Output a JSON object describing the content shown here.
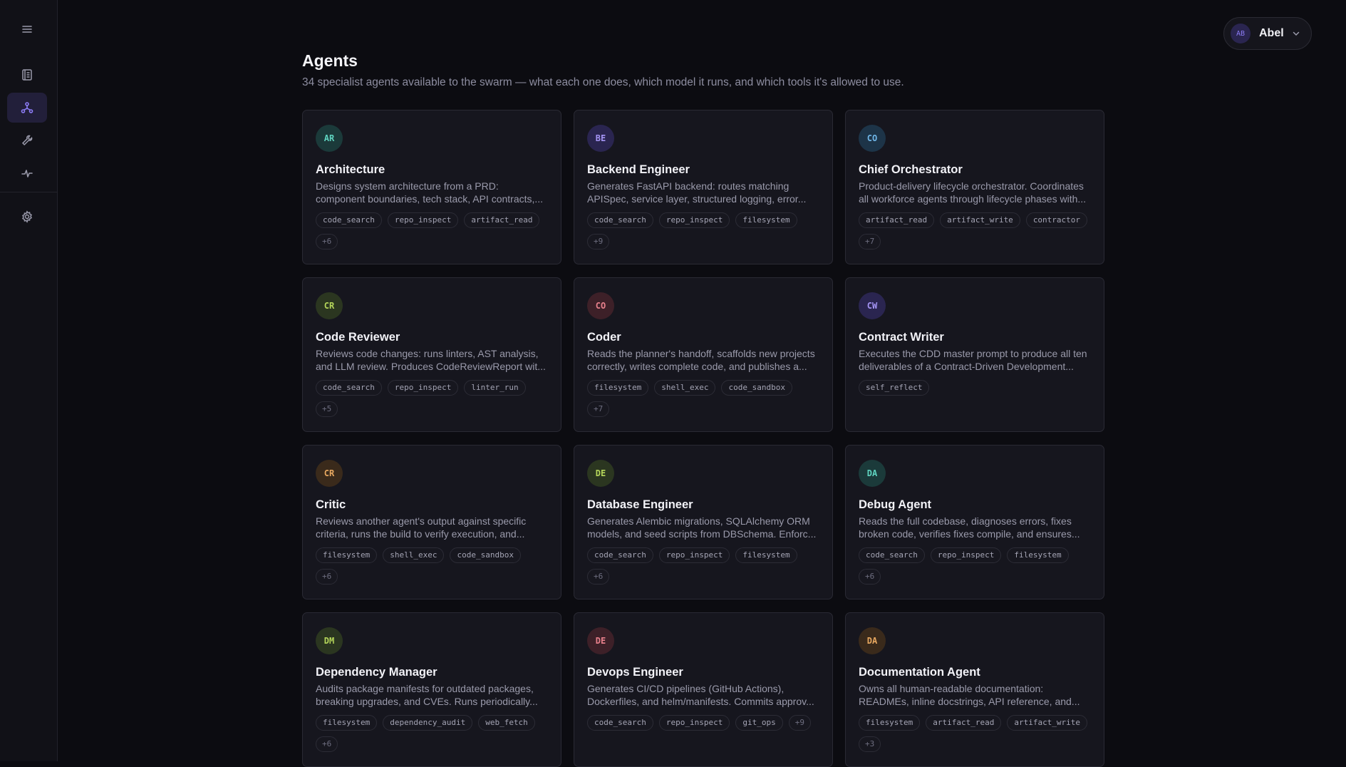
{
  "sidebar": {
    "items": [
      {
        "name": "menu-icon"
      },
      {
        "name": "docs-icon"
      },
      {
        "name": "agents-icon",
        "active": true
      },
      {
        "name": "tools-icon"
      },
      {
        "name": "activity-icon"
      },
      {
        "name": "settings-icon"
      }
    ]
  },
  "user": {
    "initials": "AB",
    "name": "Abel"
  },
  "header": {
    "title": "Agents",
    "subtitle": "34 specialist agents available to the swarm — what each one does, which model it runs, and which tools it's allowed to use."
  },
  "agents": [
    {
      "initials": "AR",
      "name": "Architecture",
      "desc": "Designs system architecture from a PRD: component boundaries, tech stack, API contracts,...",
      "tags": [
        "code_search",
        "repo_inspect",
        "artifact_read"
      ],
      "more": "+6",
      "color": "#5fd4c0",
      "bg": "#1b3a3a"
    },
    {
      "initials": "BE",
      "name": "Backend Engineer",
      "desc": "Generates FastAPI backend: routes matching APISpec, service layer, structured logging, error...",
      "tags": [
        "code_search",
        "repo_inspect",
        "filesystem"
      ],
      "more": "+9",
      "color": "#a595f5",
      "bg": "#2a2550"
    },
    {
      "initials": "CO",
      "name": "Chief Orchestrator",
      "desc": "Product-delivery lifecycle orchestrator. Coordinates all workforce agents through lifecycle phases with...",
      "tags": [
        "artifact_read",
        "artifact_write",
        "contractor"
      ],
      "more": "+7",
      "color": "#6fb6e8",
      "bg": "#1d3448"
    },
    {
      "initials": "CR",
      "name": "Code Reviewer",
      "desc": "Reviews code changes: runs linters, AST analysis, and LLM review. Produces CodeReviewReport wit...",
      "tags": [
        "code_search",
        "repo_inspect",
        "linter_run"
      ],
      "more": "+5",
      "color": "#b5d65a",
      "bg": "#2b3620"
    },
    {
      "initials": "CO",
      "name": "Coder",
      "desc": "Reads the planner's handoff, scaffolds new projects correctly, writes complete code, and publishes a...",
      "tags": [
        "filesystem",
        "shell_exec",
        "code_sandbox"
      ],
      "more": "+7",
      "color": "#e8808c",
      "bg": "#3d2028"
    },
    {
      "initials": "CW",
      "name": "Contract Writer",
      "desc": "Executes the CDD master prompt to produce all ten deliverables of a Contract-Driven Development...",
      "tags": [
        "self_reflect"
      ],
      "more": "",
      "color": "#a595f5",
      "bg": "#2a2550"
    },
    {
      "initials": "CR",
      "name": "Critic",
      "desc": "Reviews another agent's output against specific criteria, runs the build to verify execution, and...",
      "tags": [
        "filesystem",
        "shell_exec",
        "code_sandbox"
      ],
      "more": "+6",
      "color": "#e8a860",
      "bg": "#3a2a1b"
    },
    {
      "initials": "DE",
      "name": "Database Engineer",
      "desc": "Generates Alembic migrations, SQLAlchemy ORM models, and seed scripts from DBSchema. Enforc...",
      "tags": [
        "code_search",
        "repo_inspect",
        "filesystem"
      ],
      "more": "+6",
      "color": "#b5d65a",
      "bg": "#2b3620"
    },
    {
      "initials": "DA",
      "name": "Debug Agent",
      "desc": "Reads the full codebase, diagnoses errors, fixes broken code, verifies fixes compile, and ensures...",
      "tags": [
        "code_search",
        "repo_inspect",
        "filesystem"
      ],
      "more": "+6",
      "color": "#5fd4c0",
      "bg": "#1b3a3a"
    },
    {
      "initials": "DM",
      "name": "Dependency Manager",
      "desc": "Audits package manifests for outdated packages, breaking upgrades, and CVEs. Runs periodically...",
      "tags": [
        "filesystem",
        "dependency_audit",
        "web_fetch"
      ],
      "more": "+6",
      "color": "#b5d65a",
      "bg": "#2b3620"
    },
    {
      "initials": "DE",
      "name": "Devops Engineer",
      "desc": "Generates CI/CD pipelines (GitHub Actions), Dockerfiles, and helm/manifests. Commits approv...",
      "tags": [
        "code_search",
        "repo_inspect",
        "git_ops"
      ],
      "more": "+9",
      "color": "#e8808c",
      "bg": "#3d2028"
    },
    {
      "initials": "DA",
      "name": "Documentation Agent",
      "desc": "Owns all human-readable documentation: READMEs, inline docstrings, API reference, and...",
      "tags": [
        "filesystem",
        "artifact_read",
        "artifact_write"
      ],
      "more": "+3",
      "color": "#e8a860",
      "bg": "#3a2a1b"
    }
  ]
}
